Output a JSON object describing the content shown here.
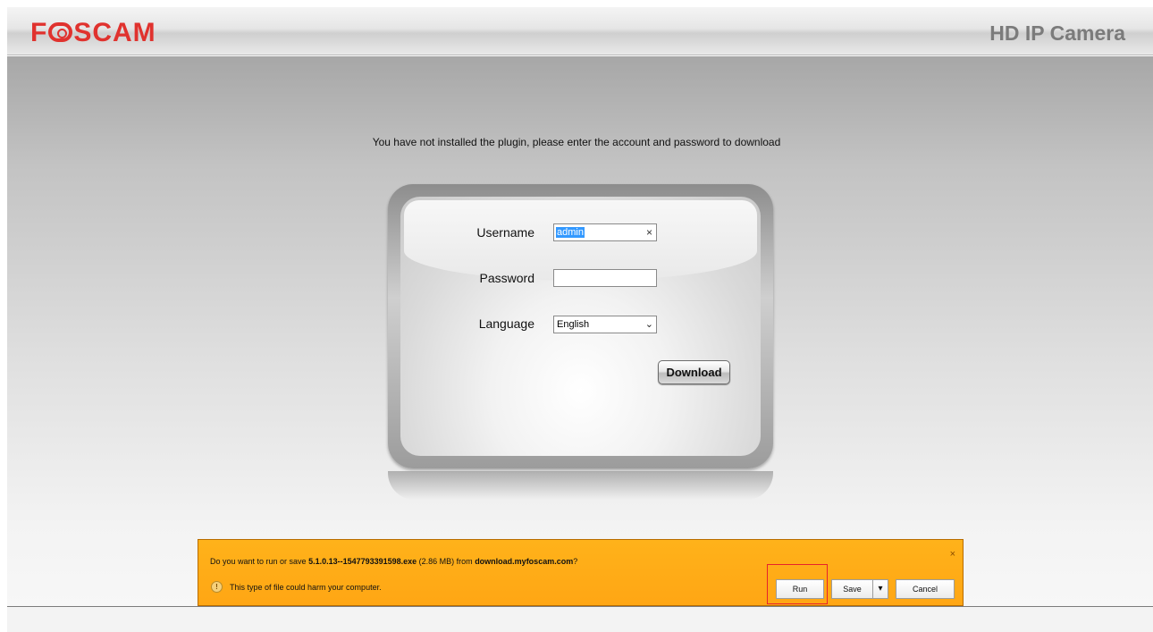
{
  "header": {
    "logo_text_1": "F",
    "logo_text_2": "SCAM",
    "logo_icon": "camera-lens-icon",
    "product_title": "HD IP Camera"
  },
  "notice": "You have not installed the plugin, please enter the account and password to download",
  "form": {
    "username_label": "Username",
    "username_value": "admin",
    "password_label": "Password",
    "password_value": "",
    "language_label": "Language",
    "language_value": "English",
    "download_label": "Download"
  },
  "download_bar": {
    "question_prefix": "Do you want to run or save ",
    "file_name": "5.1.0.13--1547793391598.exe",
    "file_size": " (2.86 MB) from ",
    "source": "download.myfoscam.com",
    "question_suffix": "?",
    "warning": "This type of file could harm your computer.",
    "run_label": "Run",
    "save_label": "Save",
    "cancel_label": "Cancel",
    "close_icon": "close-icon",
    "warning_icon": "warning-icon",
    "save_menu_icon": "chevron-down-icon"
  },
  "colors": {
    "brand": "#e0322e",
    "download_bar": "#ffa614",
    "highlight": "#e6232b"
  }
}
